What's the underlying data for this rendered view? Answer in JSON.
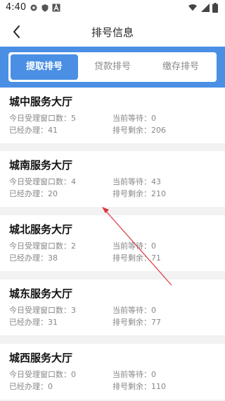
{
  "status_bar": {
    "time": "4:40",
    "icons": [
      "settings-icon",
      "shield-icon",
      "font-icon",
      "wifi-icon",
      "signal-icon",
      "battery-icon"
    ]
  },
  "header": {
    "title": "排号信息",
    "back_icon": "chevron-left-icon"
  },
  "tabs": [
    {
      "label": "提取排号",
      "active": true
    },
    {
      "label": "贷款排号",
      "active": false
    },
    {
      "label": "缴存排号",
      "active": false
    }
  ],
  "halls": [
    {
      "name": "城中服务大厅",
      "windows_label": "今日受理窗口数：",
      "windows": "5",
      "waiting_label": "当前等待：",
      "waiting": "0",
      "done_label": "已经办理：",
      "done": "41",
      "remaining_label": "排号剩余：",
      "remaining": "206"
    },
    {
      "name": "城南服务大厅",
      "windows_label": "今日受理窗口数：",
      "windows": "4",
      "waiting_label": "当前等待：",
      "waiting": "43",
      "done_label": "已经办理：",
      "done": "20",
      "remaining_label": "排号剩余：",
      "remaining": "210"
    },
    {
      "name": "城北服务大厅",
      "windows_label": "今日受理窗口数：",
      "windows": "2",
      "waiting_label": "当前等待：",
      "waiting": "0",
      "done_label": "已经办理：",
      "done": "38",
      "remaining_label": "排号剩余：",
      "remaining": "71"
    },
    {
      "name": "城东服务大厅",
      "windows_label": "今日受理窗口数：",
      "windows": "3",
      "waiting_label": "当前等待：",
      "waiting": "0",
      "done_label": "已经办理：",
      "done": "31",
      "remaining_label": "排号剩余：",
      "remaining": "77"
    },
    {
      "name": "城西服务大厅",
      "windows_label": "今日受理窗口数：",
      "windows": "0",
      "waiting_label": "当前等待：",
      "waiting": "0",
      "done_label": "已经办理：",
      "done": "0",
      "remaining_label": "排号剩余：",
      "remaining": "110"
    }
  ],
  "colors": {
    "accent": "#4a8fe3",
    "annotation": "#d9363e"
  }
}
